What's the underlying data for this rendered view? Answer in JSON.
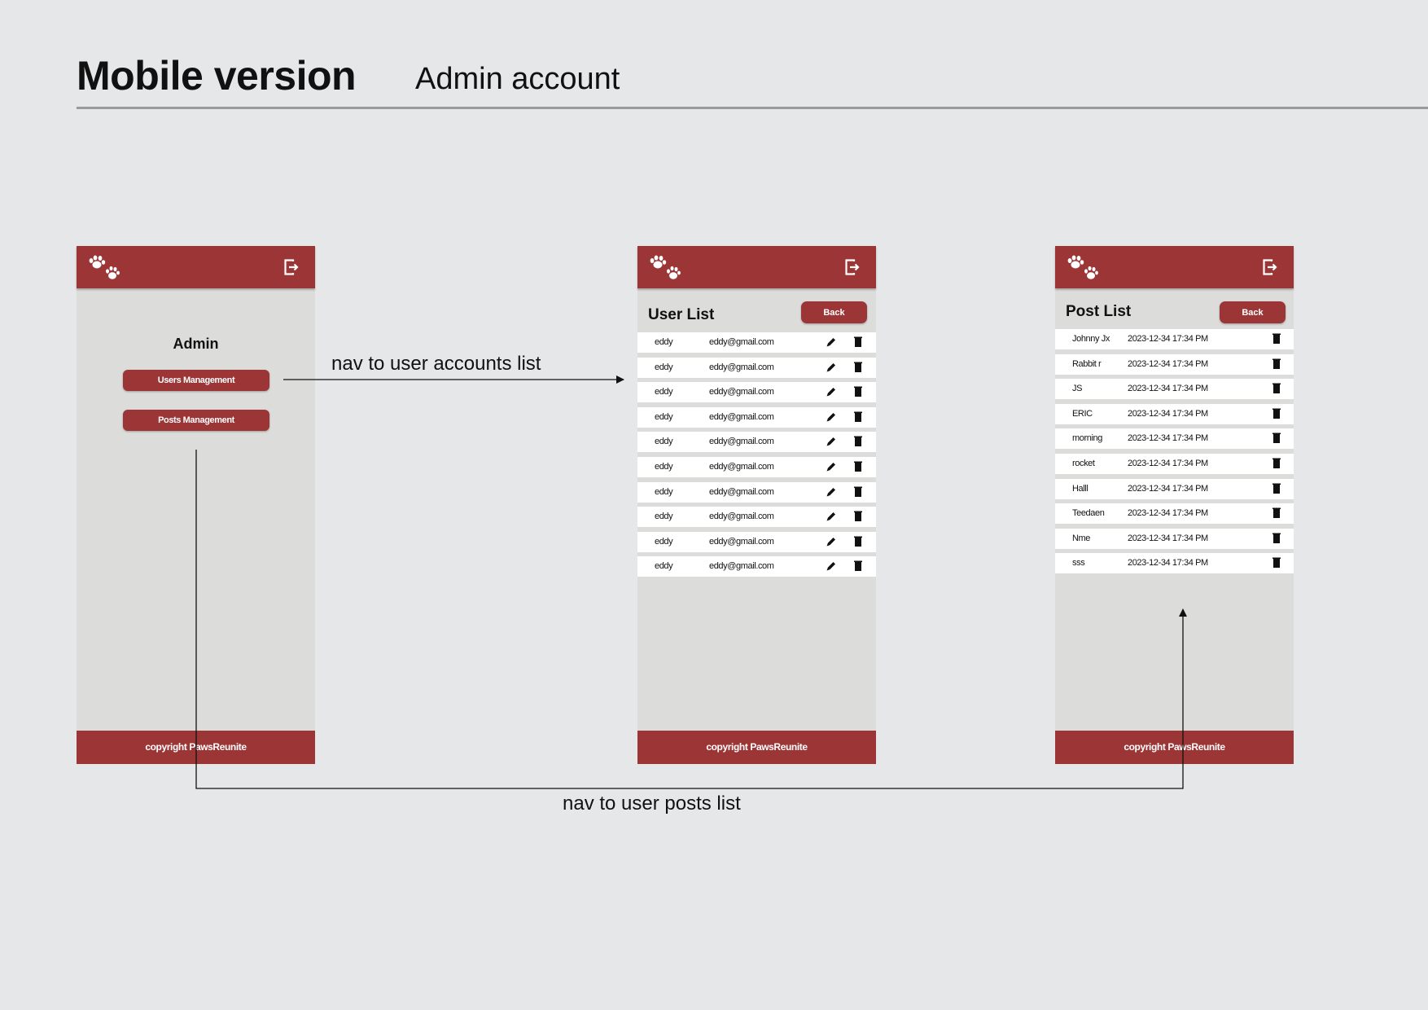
{
  "header": {
    "title": "Mobile version",
    "subtitle": "Admin account"
  },
  "brand_color": "#9b3536",
  "screens": {
    "admin_home": {
      "logo_icon": "paw-prints-icon",
      "logout_icon": "logout-icon",
      "heading": "Admin",
      "users_button": "Users Management",
      "posts_button": "Posts Management",
      "footer": "copyright PawsReunite"
    },
    "user_list": {
      "logo_icon": "paw-prints-icon",
      "logout_icon": "logout-icon",
      "title": "User List",
      "back_button": "Back",
      "rows": [
        {
          "name": "eddy",
          "email": "eddy@gmail.com"
        },
        {
          "name": "eddy",
          "email": "eddy@gmail.com"
        },
        {
          "name": "eddy",
          "email": "eddy@gmail.com"
        },
        {
          "name": "eddy",
          "email": "eddy@gmail.com"
        },
        {
          "name": "eddy",
          "email": "eddy@gmail.com"
        },
        {
          "name": "eddy",
          "email": "eddy@gmail.com"
        },
        {
          "name": "eddy",
          "email": "eddy@gmail.com"
        },
        {
          "name": "eddy",
          "email": "eddy@gmail.com"
        },
        {
          "name": "eddy",
          "email": "eddy@gmail.com"
        },
        {
          "name": "eddy",
          "email": "eddy@gmail.com"
        }
      ],
      "footer": "copyright PawsReunite"
    },
    "post_list": {
      "logo_icon": "paw-prints-icon",
      "logout_icon": "logout-icon",
      "title": "Post List",
      "back_button": "Back",
      "rows": [
        {
          "author": "Johnny Jx",
          "date": "2023-12-34 17:34 PM"
        },
        {
          "author": "Rabbit r",
          "date": "2023-12-34 17:34 PM"
        },
        {
          "author": "JS",
          "date": "2023-12-34 17:34 PM"
        },
        {
          "author": "ERIC",
          "date": "2023-12-34 17:34 PM"
        },
        {
          "author": "morning",
          "date": "2023-12-34 17:34 PM"
        },
        {
          "author": "rocket",
          "date": "2023-12-34 17:34 PM"
        },
        {
          "author": "Halll",
          "date": "2023-12-34 17:34 PM"
        },
        {
          "author": "Teedaen",
          "date": "2023-12-34 17:34 PM"
        },
        {
          "author": "Nme",
          "date": "2023-12-34 17:34 PM"
        },
        {
          "author": "sss",
          "date": "2023-12-34 17:34 PM"
        }
      ],
      "footer": "copyright PawsReunite"
    }
  },
  "annotations": {
    "to_users": "nav to user accounts list",
    "to_posts": "nav to user posts list"
  }
}
